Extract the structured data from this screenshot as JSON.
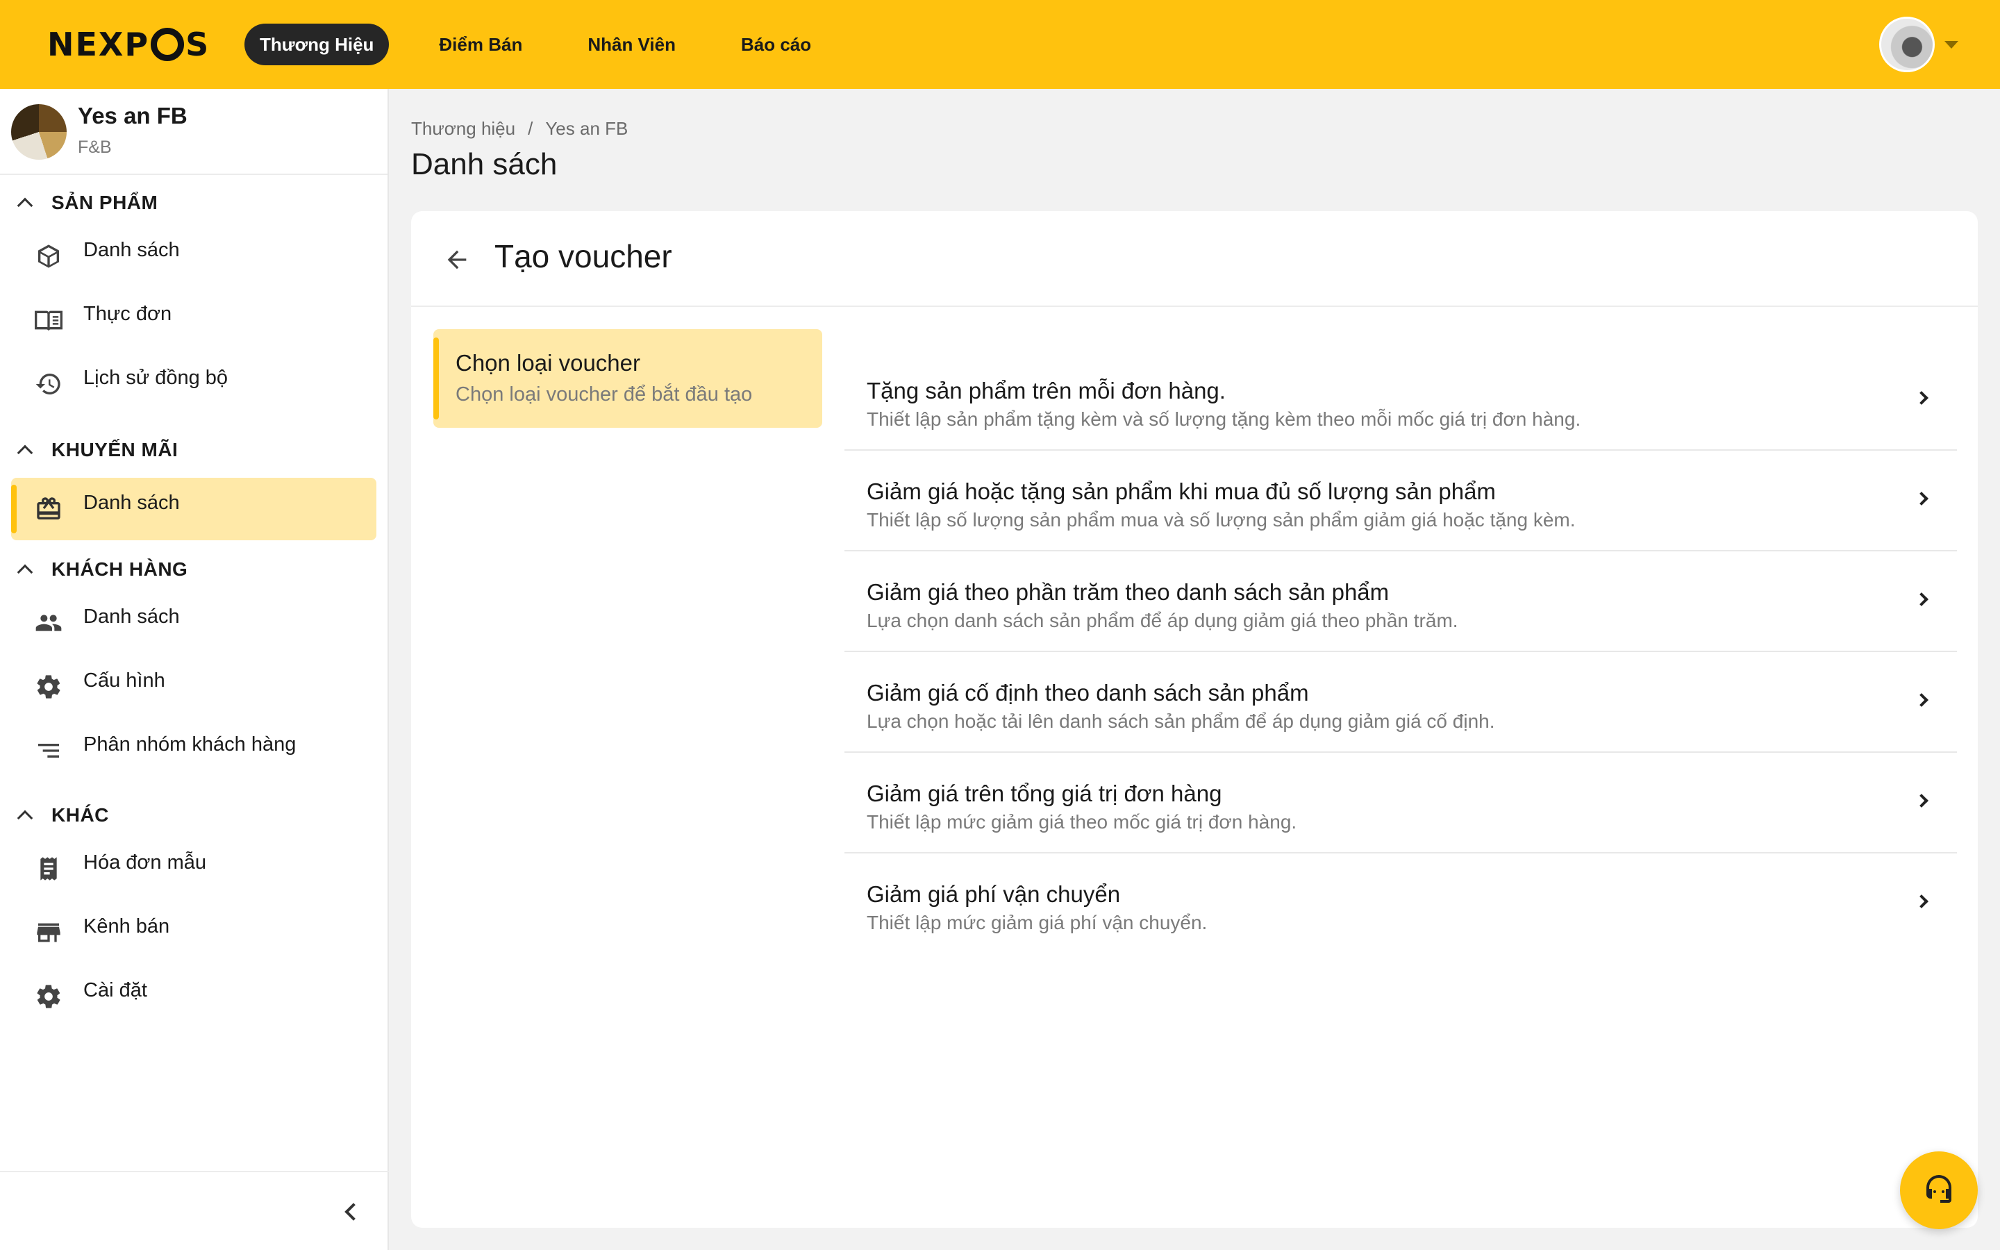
{
  "app": {
    "logo_text": "NEXPOS",
    "accent_color": "#ffc20e"
  },
  "nav": {
    "items": [
      "Thương Hiệu",
      "Điểm Bán",
      "Nhân Viên",
      "Báo cáo"
    ],
    "active_index": 0
  },
  "brand": {
    "name": "Yes an FB",
    "type": "F&B"
  },
  "sidebar": {
    "sections": [
      {
        "title": "SẢN PHẨM",
        "items": [
          {
            "label": "Danh sách",
            "icon": "cube-icon"
          },
          {
            "label": "Thực đơn",
            "icon": "menu-book-icon"
          },
          {
            "label": "Lịch sử đồng bộ",
            "icon": "history-icon"
          }
        ]
      },
      {
        "title": "KHUYẾN MÃI",
        "items": [
          {
            "label": "Danh sách",
            "icon": "gift-card-icon",
            "active": true
          }
        ]
      },
      {
        "title": "KHÁCH HÀNG",
        "items": [
          {
            "label": "Danh sách",
            "icon": "people-icon"
          },
          {
            "label": "Cấu hình",
            "icon": "gear-icon"
          },
          {
            "label": "Phân nhóm khách hàng",
            "icon": "sort-lines-icon"
          }
        ]
      },
      {
        "title": "KHÁC",
        "items": [
          {
            "label": "Hóa đơn mẫu",
            "icon": "receipt-icon"
          },
          {
            "label": "Kênh bán",
            "icon": "store-icon"
          },
          {
            "label": "Cài đặt",
            "icon": "gear-icon"
          }
        ]
      }
    ]
  },
  "breadcrumb": [
    "Thương hiệu",
    "Yes an FB"
  ],
  "page": {
    "title": "Danh sách"
  },
  "card": {
    "title": "Tạo voucher",
    "step": {
      "title": "Chọn loại voucher",
      "subtitle": "Chọn loại voucher để bắt đầu tạo"
    },
    "options": [
      {
        "title": "Tặng sản phẩm trên mỗi đơn hàng.",
        "desc": "Thiết lập sản phẩm tặng kèm và số lượng tặng kèm theo mỗi mốc giá trị đơn hàng."
      },
      {
        "title": "Giảm giá hoặc tặng sản phẩm khi mua đủ số lượng sản phẩm",
        "desc": "Thiết lập số lượng sản phẩm mua và số lượng sản phẩm giảm giá hoặc tặng kèm."
      },
      {
        "title": "Giảm giá theo phần trăm theo danh sách sản phẩm",
        "desc": "Lựa chọn danh sách sản phẩm để áp dụng giảm giá theo phần trăm."
      },
      {
        "title": "Giảm giá cố định theo danh sách sản phẩm",
        "desc": "Lựa chọn hoặc tải lên danh sách sản phẩm để áp dụng giảm giá cố định."
      },
      {
        "title": "Giảm giá trên tổng giá trị đơn hàng",
        "desc": "Thiết lập mức giảm giá theo mốc giá trị đơn hàng."
      },
      {
        "title": "Giảm giá phí vận chuyển",
        "desc": "Thiết lập mức giảm giá phí vận chuyển."
      }
    ]
  }
}
